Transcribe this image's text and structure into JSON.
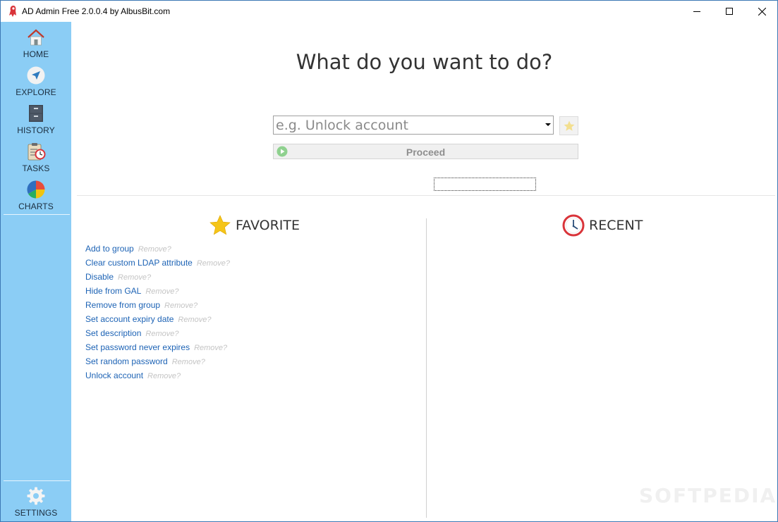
{
  "window": {
    "title": "AD Admin Free 2.0.0.4 by AlbusBit.com"
  },
  "sidebar": {
    "items": [
      {
        "label": "HOME",
        "icon": "home-icon"
      },
      {
        "label": "EXPLORE",
        "icon": "navigation-icon"
      },
      {
        "label": "HISTORY",
        "icon": "file-cabinet-icon"
      },
      {
        "label": "TASKS",
        "icon": "clipboard-clock-icon"
      },
      {
        "label": "CHARTS",
        "icon": "pie-chart-icon"
      }
    ],
    "settings": {
      "label": "SETTINGS",
      "icon": "gear-icon"
    }
  },
  "main": {
    "heading": "What do you want to do?",
    "task_combo": {
      "placeholder": "e.g. Unlock account"
    },
    "proceed_label": "Proceed",
    "favorite": {
      "title": "FAVORITE",
      "remove_label": "Remove?",
      "items": [
        "Add to group",
        "Clear custom LDAP attribute",
        "Disable",
        "Hide from GAL",
        "Remove from group",
        "Set account expiry date",
        "Set description",
        "Set password never expires",
        "Set random password",
        "Unlock account"
      ]
    },
    "recent": {
      "title": "RECENT"
    }
  },
  "watermark": "SOFTPEDIA",
  "colors": {
    "sidebar": "#8bcdf5",
    "link": "#1d63b5",
    "remove": "#c4c4c4",
    "star": "#f5c518"
  }
}
